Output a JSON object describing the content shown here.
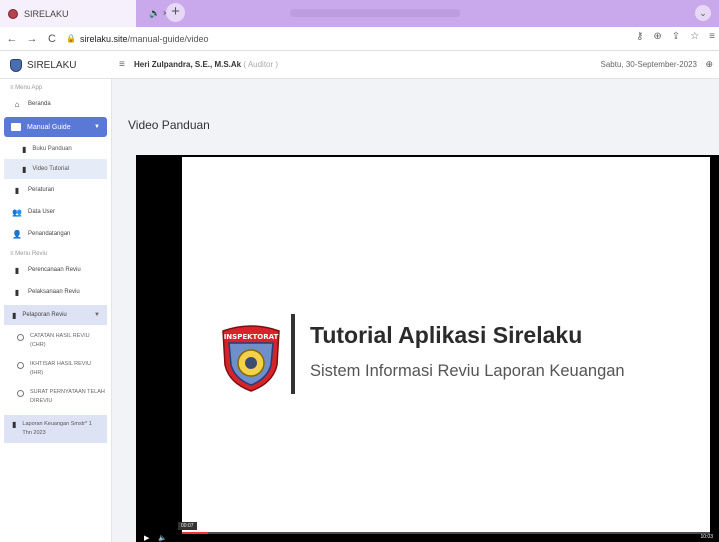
{
  "browser": {
    "tab_title": "SIRELAKU",
    "tab_controls": "🔈 ×",
    "new_tab": "+",
    "back": "←",
    "forward": "→",
    "reload": "C",
    "url_host": "sirelaku.site",
    "url_path": "/manual-guide/video",
    "window_control": "⌄",
    "right_icons": [
      "key-icon",
      "zoom-icon",
      "share-icon",
      "star-icon",
      "menu-icon"
    ]
  },
  "header": {
    "brand": "SIRELAKU",
    "menu_toggle": "≡",
    "user_name": "Heri Zulpandra, S.E., M.S.Ak",
    "user_role": "( Auditor )",
    "date": "Sabtu, 30-September-2023"
  },
  "sidebar": {
    "section_app": "≡ Menu App",
    "beranda": "Beranda",
    "manual_guide": "Manual Guide",
    "buku_panduan": "Buku Panduan",
    "video_tutorial": "Video Tutorial",
    "peraturan": "Peraturan",
    "data_user": "Data User",
    "penandatangan": "Penandatangan",
    "section_reviu": "≡ Menu Reviu",
    "perencanaan": "Perencanaan Reviu",
    "pelaksanaan": "Pelaksanaan Reviu",
    "pelaporan": "Pelaporan Reviu",
    "catatan": "CATATAN HASIL REVIU (CHR)",
    "ikhtisar": "IKHTISAR HASIL REVIU (IHR)",
    "surat": "SURAT PERNYATAAN TELAH DIREVIU",
    "laporan": "Laporan Keuangan Smstr* 1 Thn 2023"
  },
  "main": {
    "page_title": "Video Panduan",
    "video": {
      "badge_text": "INSPEKTORAT",
      "title": "Tutorial Aplikasi Sirelaku",
      "subtitle": "Sistem Informasi Reviu Laporan Keuangan",
      "tooltip": "00:07",
      "progress": 0.05,
      "time": "10:03"
    }
  },
  "colors": {
    "accent": "#5a78d6",
    "tabstrip": "#c9a9ec"
  }
}
